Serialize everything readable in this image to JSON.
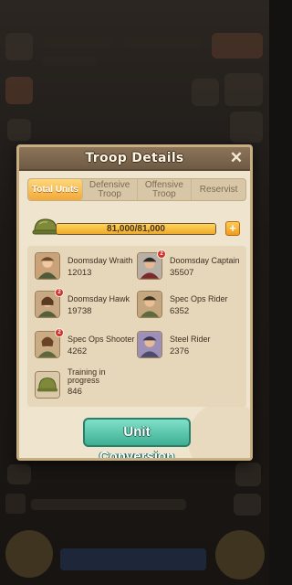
{
  "modal": {
    "title": "Troop Details",
    "close_icon": "close-icon"
  },
  "tabs": [
    {
      "label": "Total Units",
      "active": true
    },
    {
      "label": "Defensive Troop",
      "active": false
    },
    {
      "label": "Offensive Troop",
      "active": false
    },
    {
      "label": "Reservist",
      "active": false
    }
  ],
  "capacity": {
    "text": "81,000/81,000",
    "fill_fraction": 1.0,
    "icon": "helmet-icon",
    "add_icon": "plus-icon",
    "add_label": "+"
  },
  "units": [
    {
      "name": "Doomsday Wraith",
      "count": "12013",
      "badge": ""
    },
    {
      "name": "Doomsday Captain",
      "count": "35507",
      "badge": "2"
    },
    {
      "name": "Doomsday Hawk",
      "count": "19738",
      "badge": "2"
    },
    {
      "name": "Spec Ops Rider",
      "count": "6352",
      "badge": ""
    },
    {
      "name": "Spec Ops Shooter",
      "count": "4262",
      "badge": "2"
    },
    {
      "name": "Steel Rider",
      "count": "2376",
      "badge": ""
    },
    {
      "name": "Training in progress",
      "count": "846",
      "badge": ""
    }
  ],
  "convert_button": {
    "label": "Unit Conversion"
  },
  "colors": {
    "accent_gold": "#f2a93a",
    "button_teal": "#3eaf93",
    "modal_bg": "#ecdfc6"
  }
}
